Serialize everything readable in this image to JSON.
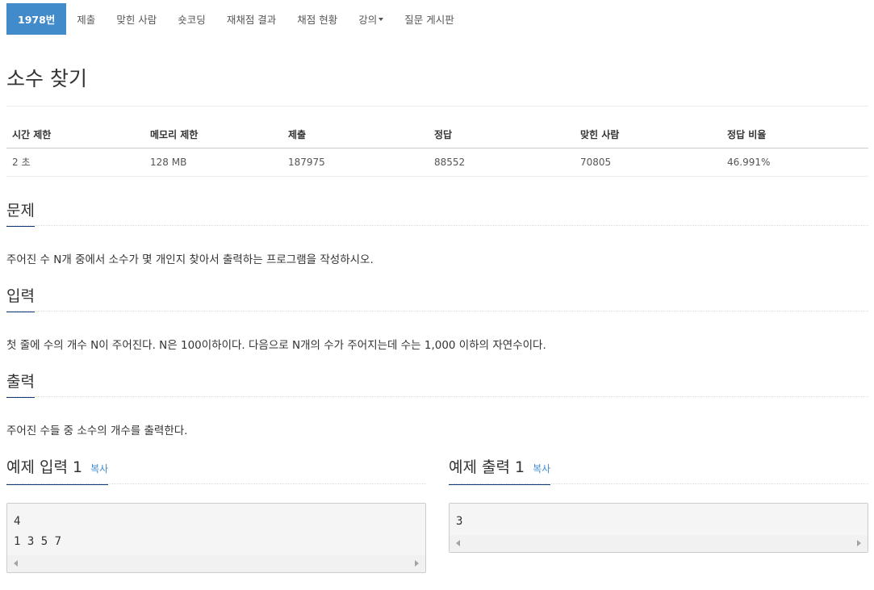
{
  "nav": {
    "tabs": [
      {
        "label": "1978번",
        "active": true
      },
      {
        "label": "제출"
      },
      {
        "label": "맞힌 사람"
      },
      {
        "label": "숏코딩"
      },
      {
        "label": "재채점 결과"
      },
      {
        "label": "채점 현황"
      },
      {
        "label": "강의",
        "dropdown": true
      },
      {
        "label": "질문 게시판"
      }
    ]
  },
  "problem": {
    "title": "소수 찾기"
  },
  "info_table": {
    "headers": [
      "시간 제한",
      "메모리 제한",
      "제출",
      "정답",
      "맞힌 사람",
      "정답 비율"
    ],
    "values": [
      "2 초",
      "128 MB",
      "187975",
      "88552",
      "70805",
      "46.991%"
    ]
  },
  "sections": {
    "description": {
      "heading": "문제",
      "text": "주어진 수 N개 중에서 소수가 몇 개인지 찾아서 출력하는 프로그램을 작성하시오."
    },
    "input": {
      "heading": "입력",
      "text": "첫 줄에 수의 개수 N이 주어진다. N은 100이하이다. 다음으로 N개의 수가 주어지는데 수는 1,000 이하의 자연수이다."
    },
    "output": {
      "heading": "출력",
      "text": "주어진 수들 중 소수의 개수를 출력한다."
    }
  },
  "samples": {
    "input": {
      "heading": "예제 입력 1",
      "copy_label": "복사",
      "content": "4\n1 3 5 7"
    },
    "output": {
      "heading": "예제 출력 1",
      "copy_label": "복사",
      "content": "3"
    }
  },
  "colors": {
    "accent": "#428bca",
    "heading_underline": "#0d3a77"
  }
}
